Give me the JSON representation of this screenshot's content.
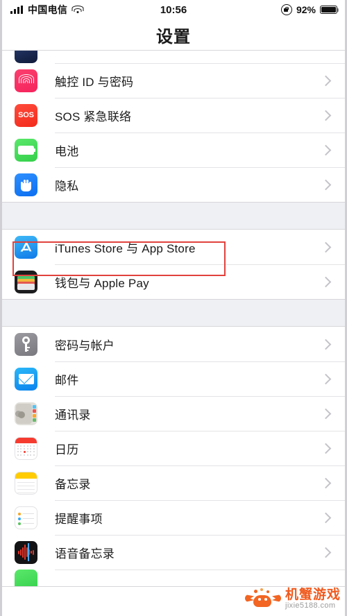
{
  "status_bar": {
    "carrier": "中国电信",
    "time": "10:56",
    "battery_percent": "92%",
    "signal_icon": "signal-bars-icon",
    "wifi_icon": "wifi-icon",
    "rotation_lock_icon": "rotation-lock-icon",
    "battery_icon": "battery-icon"
  },
  "nav": {
    "title": "设置"
  },
  "groups": [
    {
      "id": "group-security",
      "rows": [
        {
          "label": "",
          "icon": "partial-app-icon",
          "partial": true
        },
        {
          "label": "触控 ID 与密码",
          "icon": "touch-id-icon"
        },
        {
          "label": "SOS 紧急联络",
          "icon": "sos-icon"
        },
        {
          "label": "电池",
          "icon": "battery-settings-icon"
        },
        {
          "label": "隐私",
          "icon": "privacy-hand-icon"
        }
      ]
    },
    {
      "id": "group-stores",
      "rows": [
        {
          "label": "iTunes Store 与 App Store",
          "icon": "app-store-icon",
          "highlighted": true
        },
        {
          "label": "钱包与 Apple Pay",
          "icon": "wallet-icon"
        }
      ]
    },
    {
      "id": "group-apps",
      "rows": [
        {
          "label": "密码与帐户",
          "icon": "passwords-key-icon"
        },
        {
          "label": "邮件",
          "icon": "mail-envelope-icon"
        },
        {
          "label": "通讯录",
          "icon": "contacts-icon"
        },
        {
          "label": "日历",
          "icon": "calendar-icon"
        },
        {
          "label": "备忘录",
          "icon": "notes-icon"
        },
        {
          "label": "提醒事项",
          "icon": "reminders-icon"
        },
        {
          "label": "语音备忘录",
          "icon": "voice-memos-icon"
        },
        {
          "label": "",
          "icon": "phone-green-icon",
          "partial": true
        }
      ]
    }
  ],
  "highlight": {
    "target_label": "iTunes Store 与 App Store",
    "color": "#e0413c"
  },
  "watermark": {
    "title": "机蟹游戏",
    "url": "jixie5188.com",
    "logo_icon": "crab-logo-icon",
    "color": "#f05a1e"
  },
  "colors": {
    "background": "#ffffff",
    "group_gap": "#eff0f4",
    "separator": "#e3e3e6",
    "chevron": "#c3c3c8",
    "label_text": "#1b1b1b"
  }
}
